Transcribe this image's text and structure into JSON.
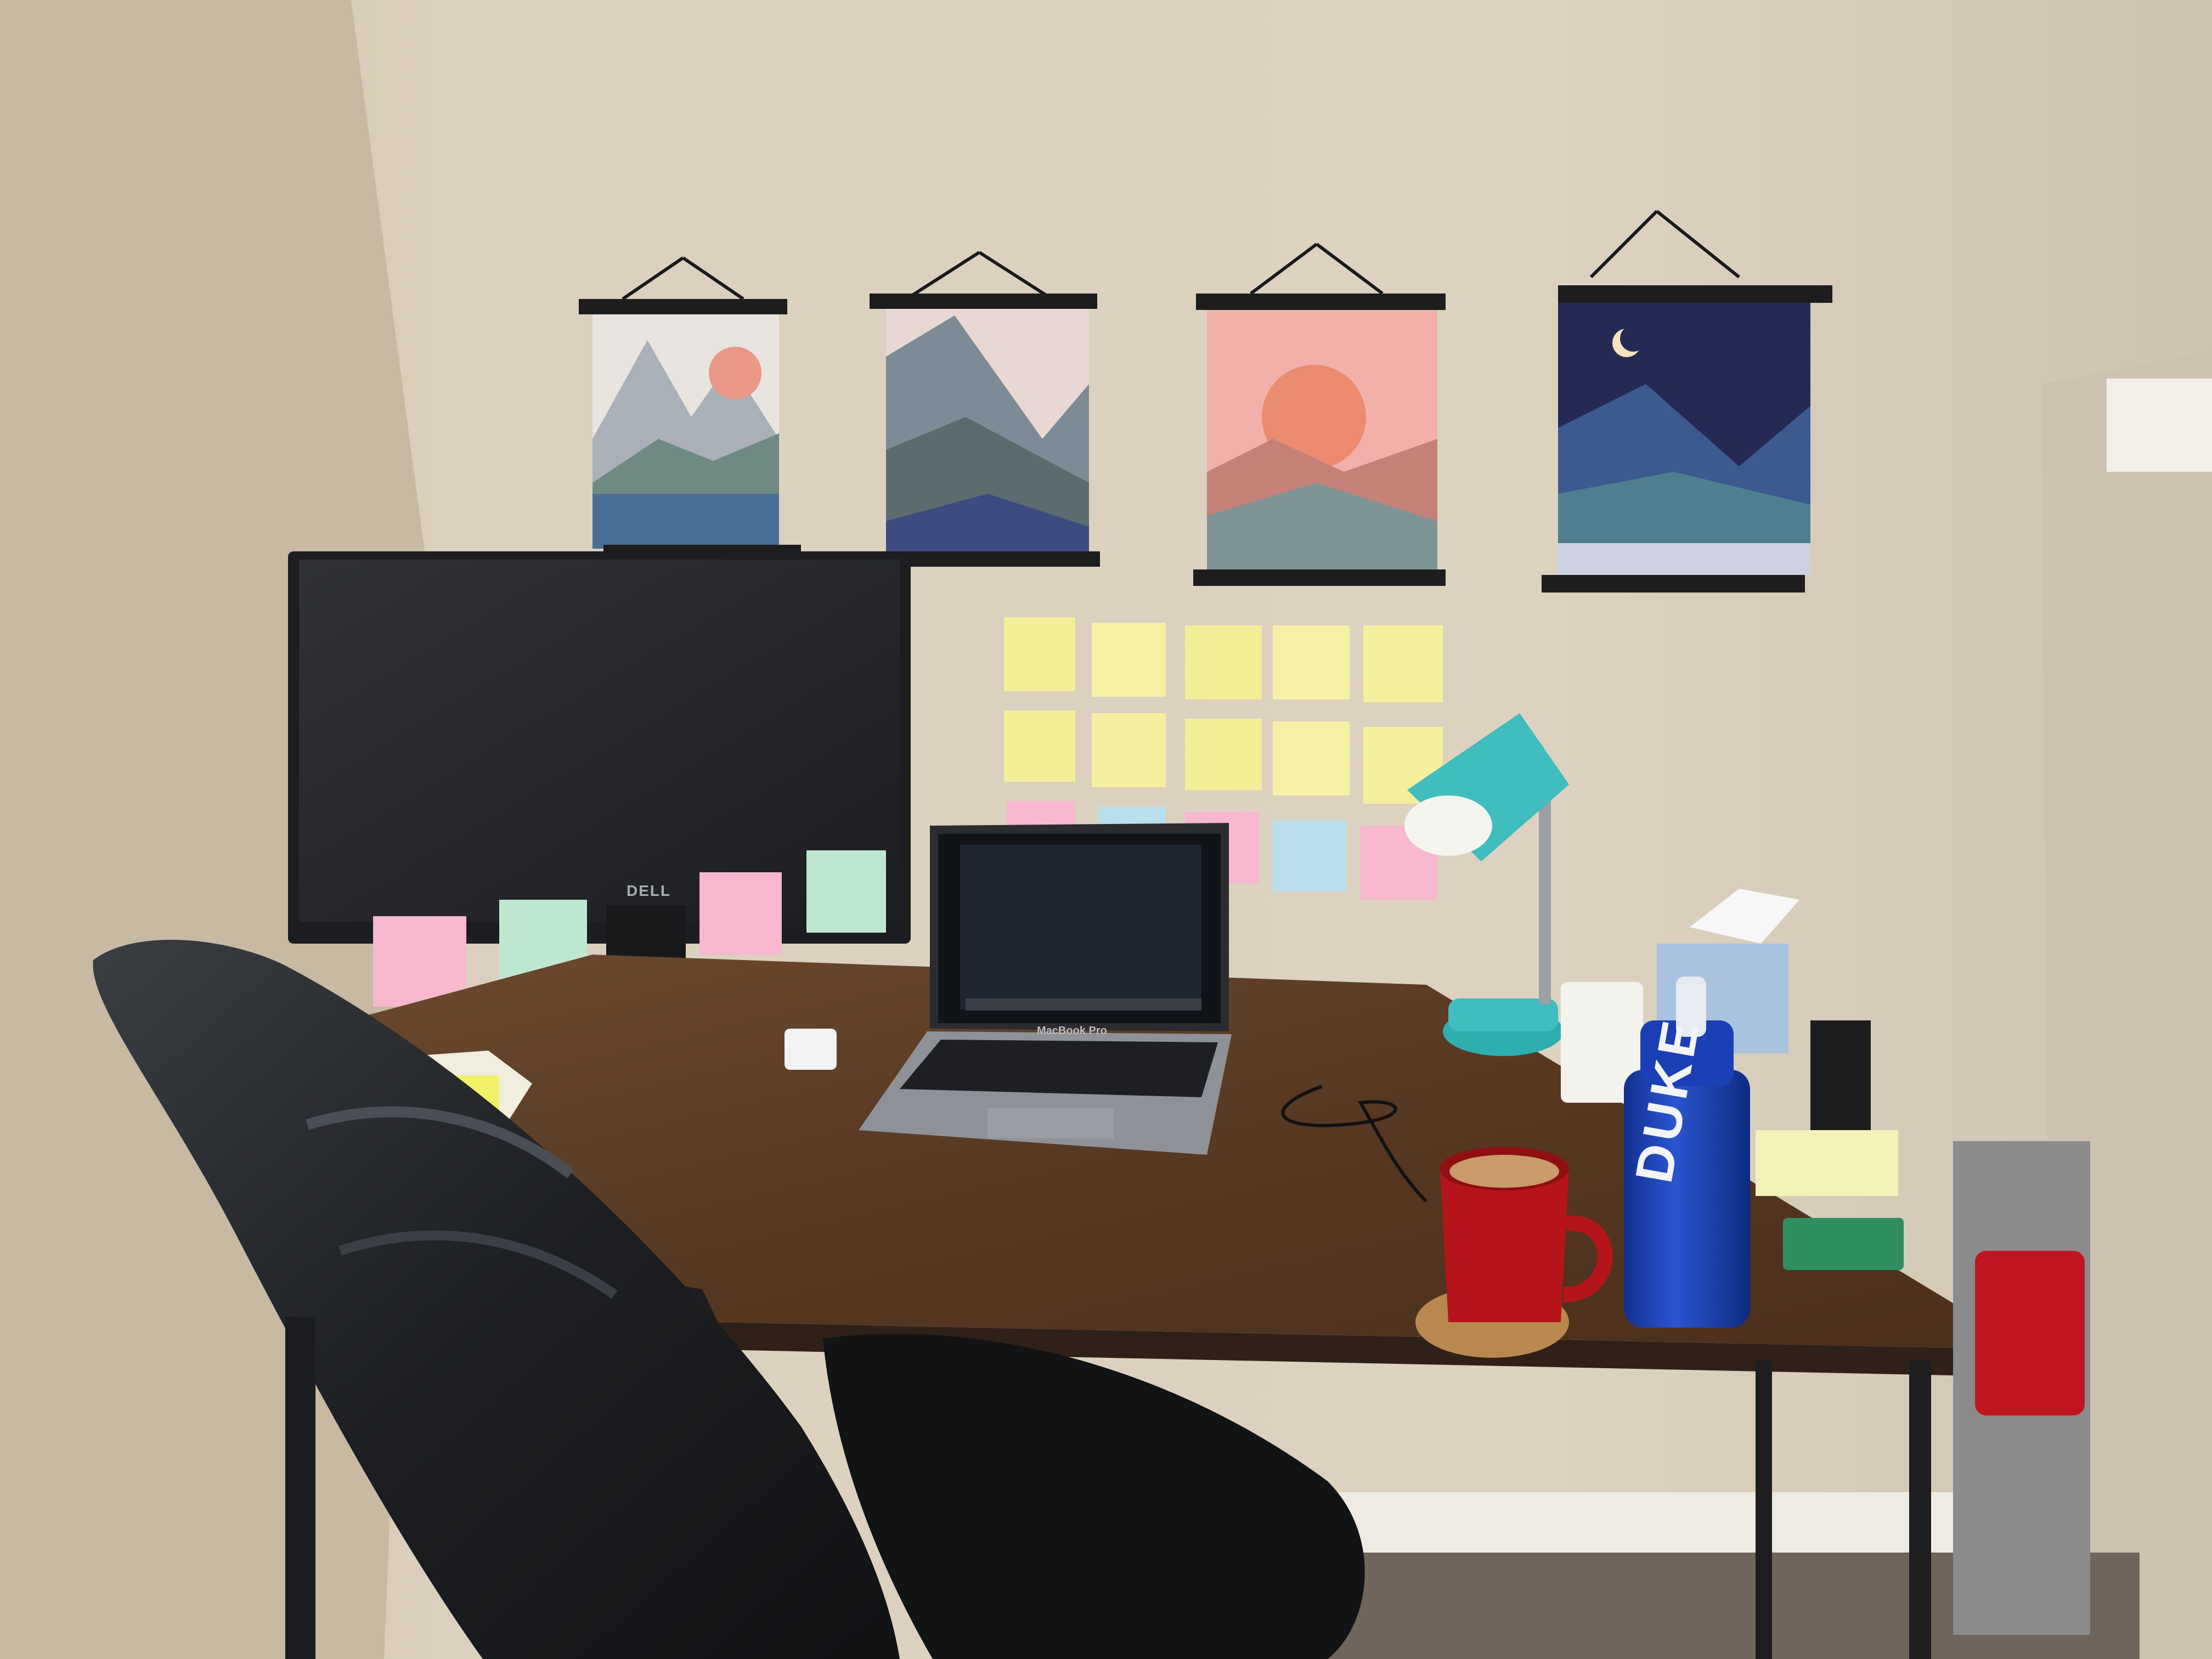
{
  "scene": {
    "description_labels": [],
    "monitor_brand": "DELL",
    "laptop_label": "MacBook Pro",
    "bottle_brand": "DUKE",
    "colors": {
      "wall": "#d8cdb9",
      "wall_shadow": "#c9bfae",
      "desk_top": "#5a3a22",
      "desk_edge": "#3b2616",
      "chair": "#1f2124",
      "monitor_bezel": "#232528",
      "monitor_screen": "#2a2b2e",
      "laptop_body": "#8e9197",
      "lamp": "#3fbdbf",
      "mug": "#b5141a",
      "bottle": "#1b3fb4",
      "sticky_yellow": "#f3ef98",
      "sticky_pink": "#f6b7cf",
      "sticky_green": "#bde8cf",
      "sticky_blue": "#b9e0ea"
    },
    "icons": [
      "posters",
      "monitor",
      "laptop",
      "lamp",
      "chair",
      "mug",
      "water-bottle",
      "sticky-notes",
      "tissue-box",
      "pencil-cup"
    ]
  }
}
